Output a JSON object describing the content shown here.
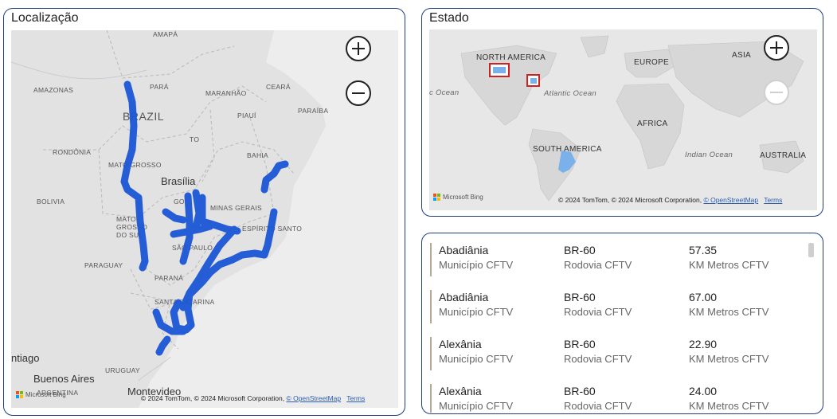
{
  "localizacao": {
    "title": "Localização",
    "labels": {
      "amapa": "AMAPÁ",
      "amazonas": "AMAZONAS",
      "para": "PARÁ",
      "maranhao": "MARANHÃO",
      "ceara": "CEARÁ",
      "brazil": "BRAZIL",
      "piaui": "PIAUÍ",
      "paraiba": "PARAÍBA",
      "to": "TO",
      "rondonia": "RONDÔNIA",
      "bahia": "BAHIA",
      "mato_grosso": "MATO GROSSO",
      "brasilia": "Brasília",
      "bolivia": "BOLIVIA",
      "goias": "GO",
      "minas": "MINAS GERAIS",
      "ms": "MATO GROSSO DO SUL",
      "sao_paulo": "SÃO PAULO",
      "espirito": "ESPÍRITO SANTO",
      "paraguay": "PARAGUAY",
      "parana": "PARANÁ",
      "santa_catarina": "SANTA CATARINA",
      "santiago": "ntiago",
      "buenos_aires": "Buenos Aires",
      "uruguay": "URUGUAY",
      "argentina": "ARGENTINA",
      "montevideo": "Montevideo"
    },
    "attribution": "© 2024 TomTom, © 2024 Microsoft Corporation,",
    "osm": "© OpenStreetMap",
    "terms": "Terms",
    "bing": "Microsoft Bing"
  },
  "estado": {
    "title": "Estado",
    "labels": {
      "north_america": "NORTH AMERICA",
      "europe": "EUROPE",
      "asia": "ASIA",
      "atlantic": "Atlantic Ocean",
      "pacific": "c Ocean",
      "africa": "AFRICA",
      "south_america": "SOUTH AMERICA",
      "indian": "Indian Ocean",
      "australia": "AUSTRALIA"
    },
    "attribution": "© 2024 TomTom, © 2024 Microsoft Corporation,",
    "osm": "© OpenStreetMap",
    "terms": "Terms",
    "bing": "Microsoft Bing"
  },
  "table": {
    "rows": [
      {
        "municipio": "Abadiânia",
        "rodovia": "BR-60",
        "km": "57.35"
      },
      {
        "municipio": "Abadiânia",
        "rodovia": "BR-60",
        "km": "67.00"
      },
      {
        "municipio": "Alexânia",
        "rodovia": "BR-60",
        "km": "22.90"
      },
      {
        "municipio": "Alexânia",
        "rodovia": "BR-60",
        "km": "24.00"
      }
    ],
    "labels": {
      "municipio": "Município CFTV",
      "rodovia": "Rodovia CFTV",
      "km": "KM Metros CFTV"
    }
  },
  "colors": {
    "route": "#1a56d6",
    "highlight_region": "#7bb1ea",
    "border": "#1f3e7a"
  }
}
